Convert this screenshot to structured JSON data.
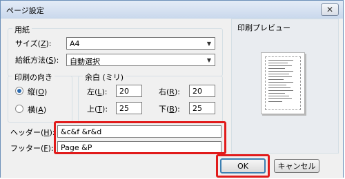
{
  "window": {
    "title": "ページ設定",
    "close_glyph": "✕"
  },
  "paper": {
    "group_label": "用紙",
    "size_label_pre": "サイズ(",
    "size_label_key": "Z",
    "size_label_post": "):",
    "size_value": "A4",
    "source_label_pre": "給紙方法(",
    "source_label_key": "S",
    "source_label_post": "):",
    "source_value": "自動選択"
  },
  "orientation": {
    "group_label": "印刷の向き",
    "portrait_pre": "縦(",
    "portrait_key": "O",
    "portrait_post": ")",
    "landscape_pre": "横(",
    "landscape_key": "A",
    "landscape_post": ")",
    "selected": "portrait"
  },
  "margins": {
    "group_label": "余白 (ミリ)",
    "left_pre": "左(",
    "left_key": "L",
    "left_post": "):",
    "left_value": "20",
    "right_pre": "右(",
    "right_key": "R",
    "right_post": "):",
    "right_value": "20",
    "top_pre": "上(",
    "top_key": "T",
    "top_post": "):",
    "top_value": "25",
    "bottom_pre": "下(",
    "bottom_key": "B",
    "bottom_post": "):",
    "bottom_value": "25"
  },
  "header": {
    "label_pre": "ヘッダー(",
    "label_key": "H",
    "label_post": "):",
    "value": "&c&f &r&d"
  },
  "footer": {
    "label_pre": "フッター(",
    "label_key": "F",
    "label_post": "):",
    "value": "Page &P"
  },
  "preview": {
    "label": "印刷プレビュー"
  },
  "buttons": {
    "ok": "OK",
    "cancel": "キャンセル"
  },
  "colors": {
    "highlight": "#e11b1b",
    "accent": "#3c7fb1"
  },
  "icons": {
    "dropdown": "chevron-down-icon",
    "close": "close-icon"
  }
}
